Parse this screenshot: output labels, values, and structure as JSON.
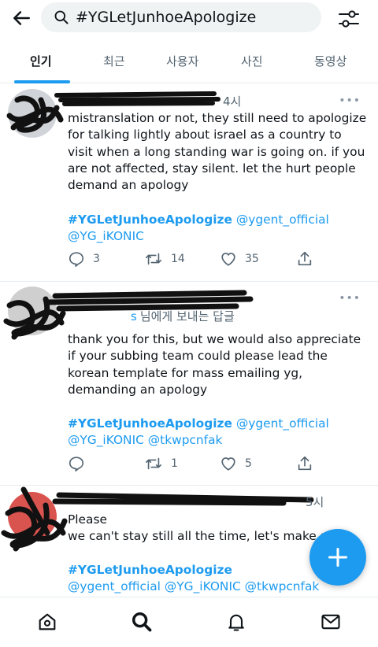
{
  "header": {
    "search_value": "#YGLetJunhoeApologize"
  },
  "tabs": [
    {
      "label": "인기",
      "active": true
    },
    {
      "label": "최근",
      "active": false
    },
    {
      "label": "사용자",
      "active": false
    },
    {
      "label": "사진",
      "active": false
    },
    {
      "label": "동영상",
      "active": false
    }
  ],
  "tweets": [
    {
      "time": "4시",
      "text": "mistranslation or not, they still need to apologize for talking lightly about israel as a country to visit when a long standing war is going on. if you are not affected, stay silent. let the hurt people demand an apology",
      "hashtag": "#YGLetJunhoeApologize",
      "mentions": [
        "@ygent_official",
        "@YG_iKONIC"
      ],
      "replies": "3",
      "retweets": "14",
      "likes": "35"
    },
    {
      "replying_user": "s",
      "replying_suffix": "님에게 보내는 답글",
      "text": "thank you for this, but we would also appreciate if your subbing team could please lead the korean template for mass emailing yg, demanding an apology",
      "hashtag": "#YGLetJunhoeApologize",
      "mentions": [
        "@ygent_official",
        "@YG_iKONIC",
        "@tkwpcnfak"
      ],
      "replies": "",
      "retweets": "1",
      "likes": "5"
    },
    {
      "time": "5시",
      "text_line1": "Please",
      "text_line2": "we can't stay still all the time, let's make a",
      "hashtag": "#YGLetJunhoeApologize",
      "mentions": [
        "@ygent_official",
        "@YG_iKONIC",
        "@tkwpcnfak"
      ]
    }
  ],
  "icons": {
    "back": "arrow-left-icon",
    "filter": "sliders-icon",
    "compose": "plus-icon",
    "nav": [
      "home-icon",
      "search-icon",
      "bell-icon",
      "mail-icon"
    ]
  },
  "colors": {
    "accent": "#1d9bf0",
    "text": "#0f1419",
    "secondary": "#536471"
  }
}
